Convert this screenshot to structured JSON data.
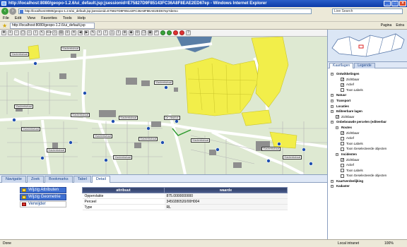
{
  "browser": {
    "title": "http://localhost:8080/geopo-1.2.6/ui_default.jsp;jsessionid=E75827D9F85143FC36A8F8EAE2ED67ep - Windows Internet Explorer",
    "address": "http://localhost:8080/geopo-1.2.6/ui_default.jsp;jsessionid=E75827D9F85143FC36A8F8EAE2ED67ep?demo",
    "search_placeholder": "Live Search",
    "menu": [
      "File",
      "Edit",
      "View",
      "Favorites",
      "Tools",
      "Help"
    ],
    "tab_title": "http://localhost:8080/geopo-1.2.6/ui_default.jsp",
    "commands": [
      "Pagina",
      "Extra"
    ]
  },
  "map": {
    "labels": [
      "Vlasbeekstraat",
      "Vlasbeekstraat",
      "Vlasbeekstraat",
      "Vlasbeekstraat",
      "Vlasbeekstraat",
      "Vlasbeekstraat",
      "Vlasbeekstraat",
      "Vlasbeekstraat",
      "Vlasbeekstraat",
      "De Vlasblok",
      "Vlasbeekstraat",
      "Vlasbeekstraat",
      "Vlasbeekstraat",
      "Vlasbeekstraat",
      "Vlasbeekstraat"
    ]
  },
  "panel": {
    "tabs": [
      "Navigatie",
      "Zoek",
      "Bookmarks",
      "Tabel",
      "Detail"
    ],
    "actions": [
      "Wijzig Attributen",
      "Wijzig Geometrie",
      "Verwijder"
    ],
    "table": {
      "headers": [
        "attribuut",
        "waarde"
      ],
      "rows": [
        [
          "Oppervlakte",
          "875.0000000000"
        ],
        [
          "Perceel",
          "3450280520/00H004"
        ],
        [
          "Type",
          "RL"
        ]
      ]
    }
  },
  "side": {
    "tabs": [
      "Kaartlagen",
      "Legende"
    ],
    "tree": [
      {
        "label": "Ontwikkelingen",
        "level": 0,
        "bold": true
      },
      {
        "label": "Zichtbaar",
        "level": 2,
        "check": true
      },
      {
        "label": "Actief",
        "level": 2,
        "check": true
      },
      {
        "label": "Toon Labels",
        "level": 2,
        "check": false
      },
      {
        "label": "Natuur",
        "level": 0,
        "bold": true
      },
      {
        "label": "Transport",
        "level": 0,
        "bold": true
      },
      {
        "label": "Locaties",
        "level": 0,
        "bold": true
      },
      {
        "label": "Editeerbare lagen",
        "level": 0,
        "bold": true
      },
      {
        "label": "Zichtbaar",
        "level": 1,
        "check": true
      },
      {
        "label": "Onbebouwde percelen (editeerbar",
        "level": 0,
        "bold": true
      },
      {
        "label": "Routes",
        "level": 1,
        "bold": true
      },
      {
        "label": "Zichtbaar",
        "level": 2,
        "check": true
      },
      {
        "label": "Actief",
        "level": 2,
        "check": false
      },
      {
        "label": "Toon Labels",
        "level": 2,
        "check": false
      },
      {
        "label": "Toon Geselecteerde objecten",
        "level": 2,
        "check": false
      },
      {
        "label": "Incidenten",
        "level": 1,
        "bold": true
      },
      {
        "label": "Zichtbaar",
        "level": 2,
        "check": true
      },
      {
        "label": "Actief",
        "level": 2,
        "check": false
      },
      {
        "label": "Toon Labels",
        "level": 2,
        "check": false
      },
      {
        "label": "Toon Geselecteerde objecten",
        "level": 2,
        "check": false
      },
      {
        "label": "Kaartverdeelijking",
        "level": 0,
        "bold": true
      },
      {
        "label": "Kadaster",
        "level": 0,
        "bold": true
      }
    ]
  },
  "status": {
    "done": "Done",
    "zone": "Local intranet",
    "zoom": "100%"
  },
  "colors": {
    "parcel_yellow": "#f2ee4a",
    "road": "#ffffff",
    "building": "#8e8e8e",
    "water": "#5a7ea6",
    "background": "#dee9d2"
  }
}
